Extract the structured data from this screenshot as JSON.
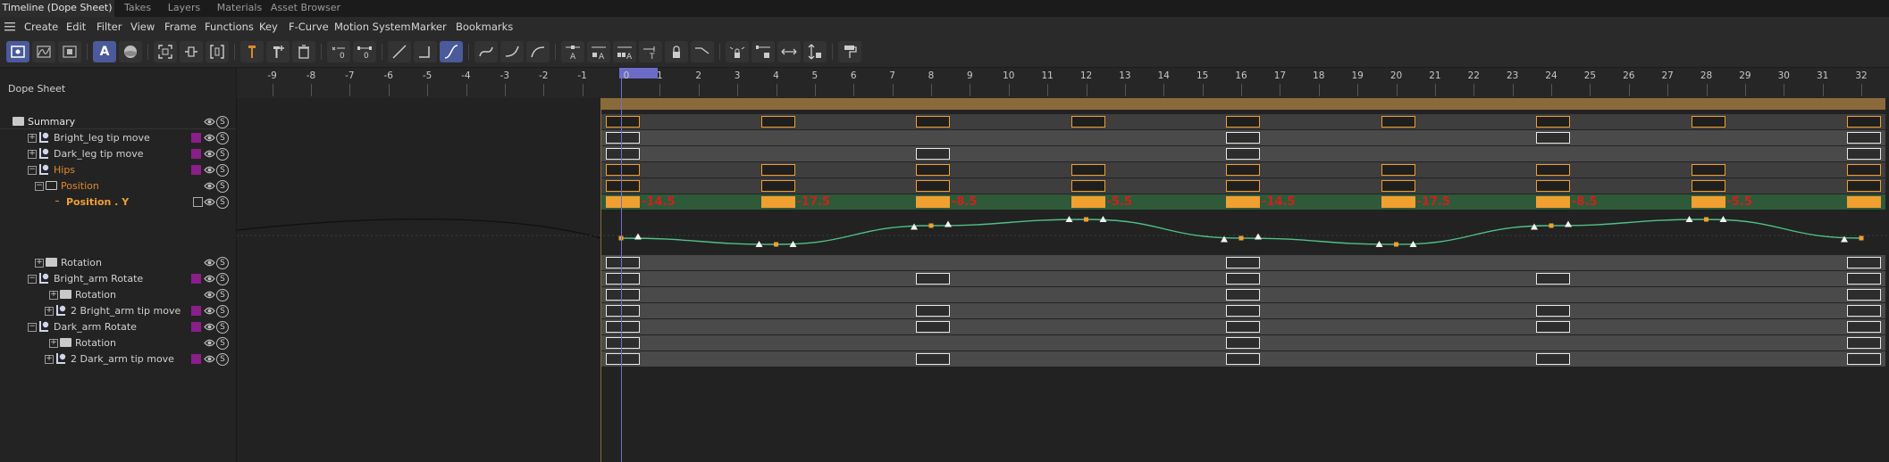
{
  "tabs": [
    {
      "label": "Timeline (Dope Sheet)",
      "active": true
    },
    {
      "label": "Takes",
      "active": false
    },
    {
      "label": "Layers",
      "active": false
    },
    {
      "label": "Materials",
      "active": false
    },
    {
      "label": "Asset Browser",
      "active": false
    }
  ],
  "menu": [
    "Create",
    "Edit",
    "Filter",
    "View",
    "Frame",
    "Functions",
    "Key",
    "F-Curve",
    "Motion System",
    "Marker",
    "Bookmarks"
  ],
  "panel_title": "Dope Sheet",
  "tracks": [
    {
      "name": "Summary",
      "icon": "folder-icon",
      "exp": "",
      "color": "#e6e6e6"
    },
    {
      "name": "Bright_leg tip move",
      "icon": "joint-icon",
      "exp": "+",
      "color": "#d0d0d0"
    },
    {
      "name": "Dark_leg tip move",
      "icon": "joint-icon",
      "exp": "+",
      "color": "#d0d0d0"
    },
    {
      "name": "Hips",
      "icon": "joint-icon",
      "exp": "−",
      "color": "#e0882b"
    },
    {
      "name": "Position",
      "icon": "folder-outline-icon",
      "exp": "−",
      "color": "#e0882b"
    },
    {
      "name": "Position . Y",
      "icon": "",
      "exp": "",
      "color": "#f0a030"
    },
    {
      "name": "Rotation",
      "icon": "folder-icon",
      "exp": "+",
      "color": "#d0d0d0"
    },
    {
      "name": "Bright_arm Rotate",
      "icon": "joint-icon",
      "exp": "−",
      "color": "#d0d0d0"
    },
    {
      "name": "Rotation",
      "icon": "folder-icon",
      "exp": "+",
      "color": "#d0d0d0"
    },
    {
      "name": "2 Bright_arm tip move",
      "icon": "joint-icon",
      "exp": "+",
      "color": "#d0d0d0"
    },
    {
      "name": "Dark_arm Rotate",
      "icon": "joint-icon",
      "exp": "−",
      "color": "#d0d0d0"
    },
    {
      "name": "Rotation",
      "icon": "folder-icon",
      "exp": "+",
      "color": "#d0d0d0"
    },
    {
      "name": "2 Dark_arm tip move",
      "icon": "joint-icon",
      "exp": "+",
      "color": "#d0d0d0"
    }
  ],
  "solo_glyph": "S",
  "ruler": {
    "start": -9,
    "end": 32
  },
  "playhead_frame": 0,
  "keyframes": {
    "summary": [
      0,
      4,
      8,
      12,
      16,
      20,
      24,
      28,
      32
    ],
    "bright_leg": [
      0,
      16,
      24,
      32
    ],
    "dark_leg": [
      0,
      8,
      16,
      32
    ],
    "hips": [
      0,
      4,
      8,
      12,
      16,
      20,
      24,
      28,
      32
    ],
    "position": [
      0,
      4,
      8,
      12,
      16,
      20,
      24,
      28,
      32
    ],
    "rotation": [
      0,
      16,
      32
    ],
    "bright_arm": [
      0,
      8,
      16,
      24,
      32
    ],
    "bright_arm_rot": [
      0,
      16,
      32
    ],
    "bright_arm_tip": [
      0,
      8,
      16,
      24,
      32
    ],
    "dark_arm": [
      0,
      8,
      16,
      24,
      32
    ],
    "dark_arm_rot": [
      0,
      16,
      32
    ],
    "dark_arm_tip": [
      0,
      8,
      16,
      24,
      32
    ]
  },
  "position_y_values": [
    {
      "frame": 0,
      "label": "-14.5"
    },
    {
      "frame": 4,
      "label": "-17.5"
    },
    {
      "frame": 8,
      "label": "-8.5"
    },
    {
      "frame": 12,
      "label": "-5.5"
    },
    {
      "frame": 16,
      "label": "-14.5"
    },
    {
      "frame": 20,
      "label": "-17.5"
    },
    {
      "frame": 24,
      "label": "-8.5"
    },
    {
      "frame": 28,
      "label": "-5.5"
    }
  ],
  "colors": {
    "key_orange": "#f0a030",
    "value_red": "#d0201a",
    "curve": "#4fc08a",
    "summary": "#8a6a3a",
    "track_green": "#2e5a3a",
    "joint_swatch": "#8a1f8a"
  }
}
